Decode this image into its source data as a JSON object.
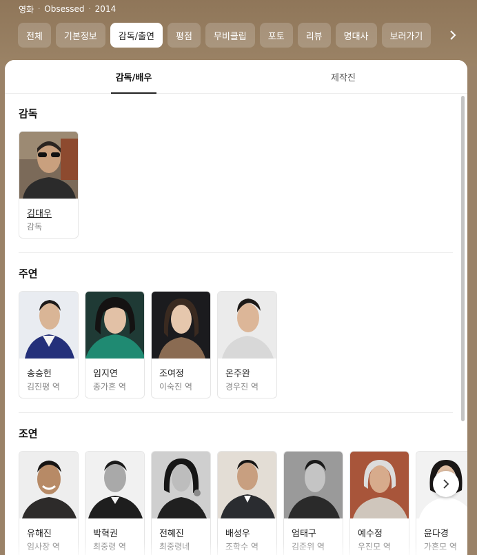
{
  "header": {
    "category": "영화",
    "title": "Obsessed",
    "year": "2014"
  },
  "chips": [
    {
      "label": "전체",
      "active": false
    },
    {
      "label": "기본정보",
      "active": false
    },
    {
      "label": "감독/출연",
      "active": true
    },
    {
      "label": "평점",
      "active": false
    },
    {
      "label": "무비클립",
      "active": false
    },
    {
      "label": "포토",
      "active": false
    },
    {
      "label": "리뷰",
      "active": false
    },
    {
      "label": "명대사",
      "active": false
    },
    {
      "label": "보러가기",
      "active": false
    }
  ],
  "tabs": [
    {
      "label": "감독/배우",
      "active": true
    },
    {
      "label": "제작진",
      "active": false
    }
  ],
  "sections": {
    "director": {
      "title": "감독",
      "people": [
        {
          "name": "김대우",
          "role": "감독"
        }
      ]
    },
    "lead": {
      "title": "주연",
      "people": [
        {
          "name": "송승헌",
          "role": "김진평 역"
        },
        {
          "name": "임지연",
          "role": "종가흔 역"
        },
        {
          "name": "조여정",
          "role": "이숙진 역"
        },
        {
          "name": "온주완",
          "role": "경우진 역"
        }
      ]
    },
    "supporting": {
      "title": "조연",
      "people": [
        {
          "name": "유해진",
          "role": "임사장 역"
        },
        {
          "name": "박혁권",
          "role": "최중령 역"
        },
        {
          "name": "전혜진",
          "role": "최중령네"
        },
        {
          "name": "배성우",
          "role": "조학수 역"
        },
        {
          "name": "엄태구",
          "role": "김준위 역"
        },
        {
          "name": "예수정",
          "role": "우진모 역"
        },
        {
          "name": "윤다경",
          "role": "가흔모 역"
        }
      ]
    }
  },
  "icons": {
    "chip_next": "chevron-right-icon",
    "carousel_next": "chevron-right-icon"
  },
  "colors": {
    "header_bg": "#9a8268",
    "active_chip_bg": "#ffffff"
  }
}
